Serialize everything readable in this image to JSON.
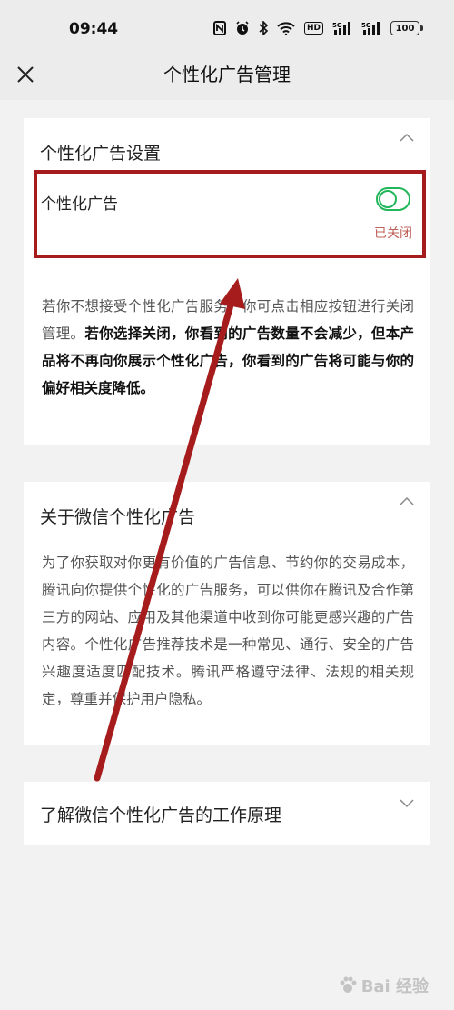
{
  "status_bar": {
    "time": "09:44",
    "hd_label": "HD",
    "signal1_label": "5G",
    "signal2_label": "5G",
    "battery": "100"
  },
  "nav": {
    "title": "个性化广告管理",
    "close_icon": "close-icon"
  },
  "settings_card": {
    "title": "个性化广告设置",
    "row_label": "个性化广告",
    "toggle_status": "已关闭",
    "desc_normal": "若你不想接受个性化广告服务，你可点击相应按钮进行关闭管理。",
    "desc_bold": "若你选择关闭，你看到的广告数量不会减少，但本产品将不再向你展示个性化广告，你看到的广告将可能与你的偏好相关度降低。"
  },
  "about_card": {
    "title": "关于微信个性化广告",
    "body": "为了你获取对你更有价值的广告信息、节约你的交易成本，腾讯向你提供个性化的广告服务，可以供你在腾讯及合作第三方的网站、应用及其他渠道中收到你可能更感兴趣的广告内容。个性化广告推荐技术是一种常见、通行、安全的广告兴趣度适度匹配技术。腾讯严格遵守法律、法规的相关规定，尊重并保护用户隐私。"
  },
  "how_card": {
    "title": "了解微信个性化广告的工作原理"
  },
  "colors": {
    "accent_green": "#22b65a",
    "status_red": "#c0605a",
    "annotation_red": "#a61c1c"
  },
  "watermark": {
    "text": "Bai 经验"
  }
}
